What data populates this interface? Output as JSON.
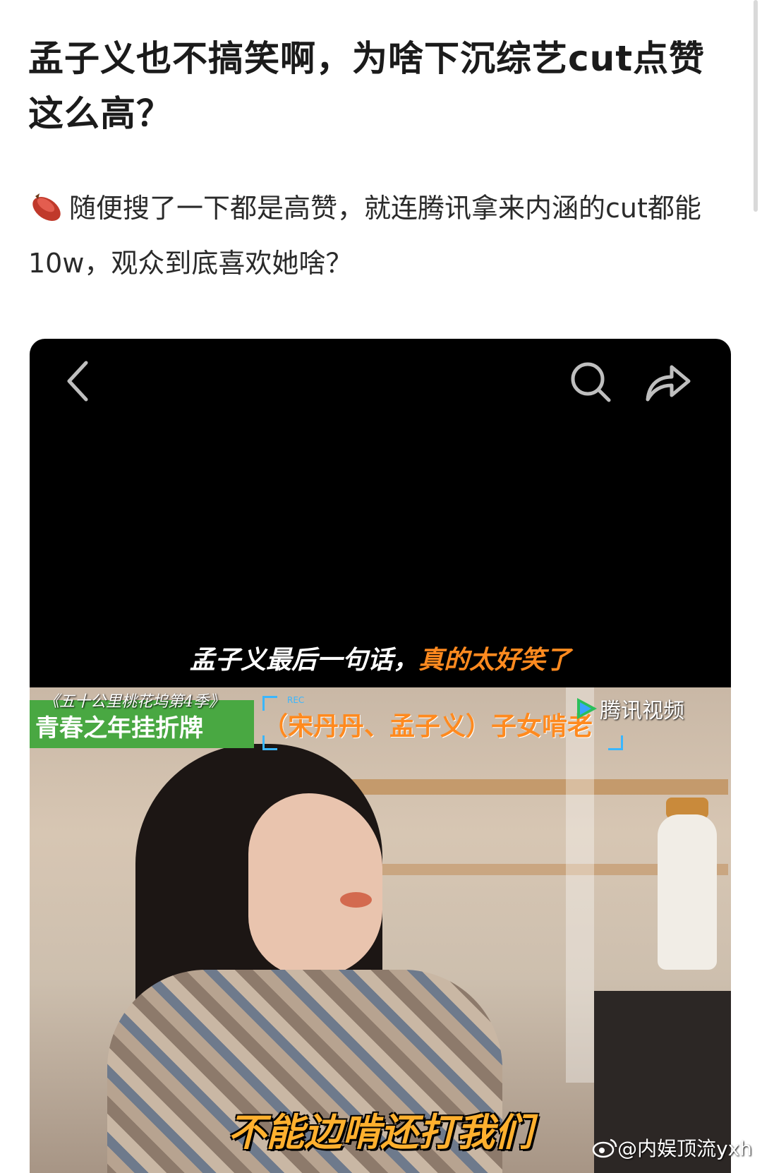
{
  "post": {
    "title": "孟子义也不搞笑啊，为啥下沉综艺cut点赞这么高？",
    "emoji": "sweet-potato-emoji",
    "body": "随便搜了一下都是高赞，就连腾讯拿来内涵的cut都能10w，观众到底喜欢她啥？"
  },
  "video": {
    "caption_top_main": "孟子义最后一句话，",
    "caption_top_highlight": "真的太好笑了",
    "show_name": "《五十公里桃花坞第4季》",
    "show_tag": "青春之年挂折牌",
    "rec_label": "REC",
    "guest_tag": "（宋丹丹、孟子义）子女啃老",
    "platform": "腾讯视频",
    "subtitle": "不能边啃还打我们"
  },
  "watermark": "@内娱顶流yxh",
  "colors": {
    "accent_orange": "#ff8a1f",
    "subtitle_yellow": "#ffb02e",
    "tag_green": "#49a842",
    "rec_blue": "#3ab6ff"
  }
}
